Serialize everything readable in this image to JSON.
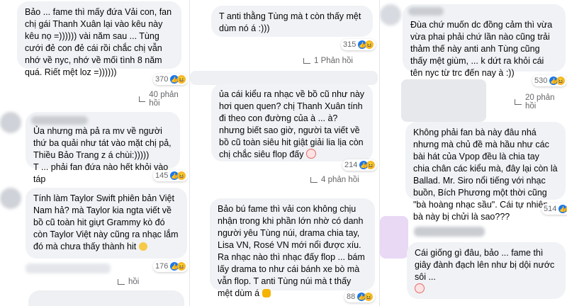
{
  "col1": {
    "comment1": {
      "text": "Bảo ... fame thì mấy đứa Vải con, fan chị gái Thanh Xuân lại vào kêu này kêu nọ =)))))) vài năm sau ... Tùng cưới đẻ con đẻ cái rồi chắc chị vẫn nhớ về nyc, nhớ về mối tình 8 năm quá. Riết mệt loz =))))))",
      "count": "370",
      "replies": "40 phản hồi"
    },
    "comment2": {
      "text": "Ủa nhưng mà pả ra mv về người thứ ba quải như tát vào mặt chị pả, Thiều Bảo Trang z á chùi:)))))\nT ... phải fan đứa nào hết khỏi vào táp",
      "count": "145"
    },
    "comment3": {
      "text": "Tính làm Taylor Swift phiên bản Việt Nam hả? mà Taylor kia ngta viết về bồ cũ toàn hit giựt Grammy kò đó còn Taylor Việt này cũng ra nhạc lắm đó mà chưa thấy thành hit",
      "count": "176",
      "replies": "hồi"
    }
  },
  "col2": {
    "comment1": {
      "text": "T anti thằng Tùng mà t còn thấy mệt dùm nó á :)))",
      "count": "315",
      "replies": "1 Phản hồi"
    },
    "comment2": {
      "text": "ủa cái kiểu ra nhạc về bồ cũ như này hơi quen quen? chị Thanh Xuân tính đi theo con đường của à ... à? nhưng biết sao giờ, người ta viết về bồ cũ toàn siêu hit giật giải lia lịa còn chị chắc siêu flop đấy",
      "count": "214",
      "replies": "4 phản hồi"
    },
    "comment3": {
      "text": "Bảo bú fame thì vải con không chịu nhận trong khi phần lớn nhờ có danh người yêu Tùng núi, drama chia tay, Lisa VN, Rosé VN mới nổi được xíu. Ra nhạc nào thì nhạc đấy flop ... bám lấy drama to như cái bánh xe bò mà vẫn flop. T anti Tùng núi mà t thấy mệt dùm á",
      "count": "88"
    }
  },
  "col3": {
    "comment1": {
      "text": "Đùa chứ muốn dc đồng cảm thì vừa vừa phai phải chứ lần nào cũng trải thảm thế này anti anh Tùng cũng thấy mệt giùm, ... k dứt ra khỏi cái tên nyc từ trc đến nay à :))",
      "count": "530",
      "replies": "20 phản hồi"
    },
    "comment2": {
      "text": "Không phải fan bà này đâu nhá nhưng mà chủ đề mà hầu như các bài hát của Vpop đều là chia tay chia chân các kiểu mà, đây lại còn là Ballad. Mr. Siro nổi tiếng với nhạc buồn, Bích Phương một thời cũng \"bà hoàng nhạc sầu\". Cái tự nhiên bà này bị chửi là sao???",
      "count": "514"
    },
    "comment3": {
      "text": "Cái giống gì đâu, bảo ... fame thì giây đành đạch lên như bị dội nước sôi ...",
      "count": ""
    }
  },
  "colors": {
    "bubble": "#f0f2f5",
    "muted": "#65676b",
    "like": "#1877f2",
    "haha": "#f7b928"
  },
  "icons": [
    "like-icon",
    "haha-icon",
    "reply-arrow-icon",
    "clown-emoji",
    "smile-emoji",
    "hand-emoji"
  ]
}
